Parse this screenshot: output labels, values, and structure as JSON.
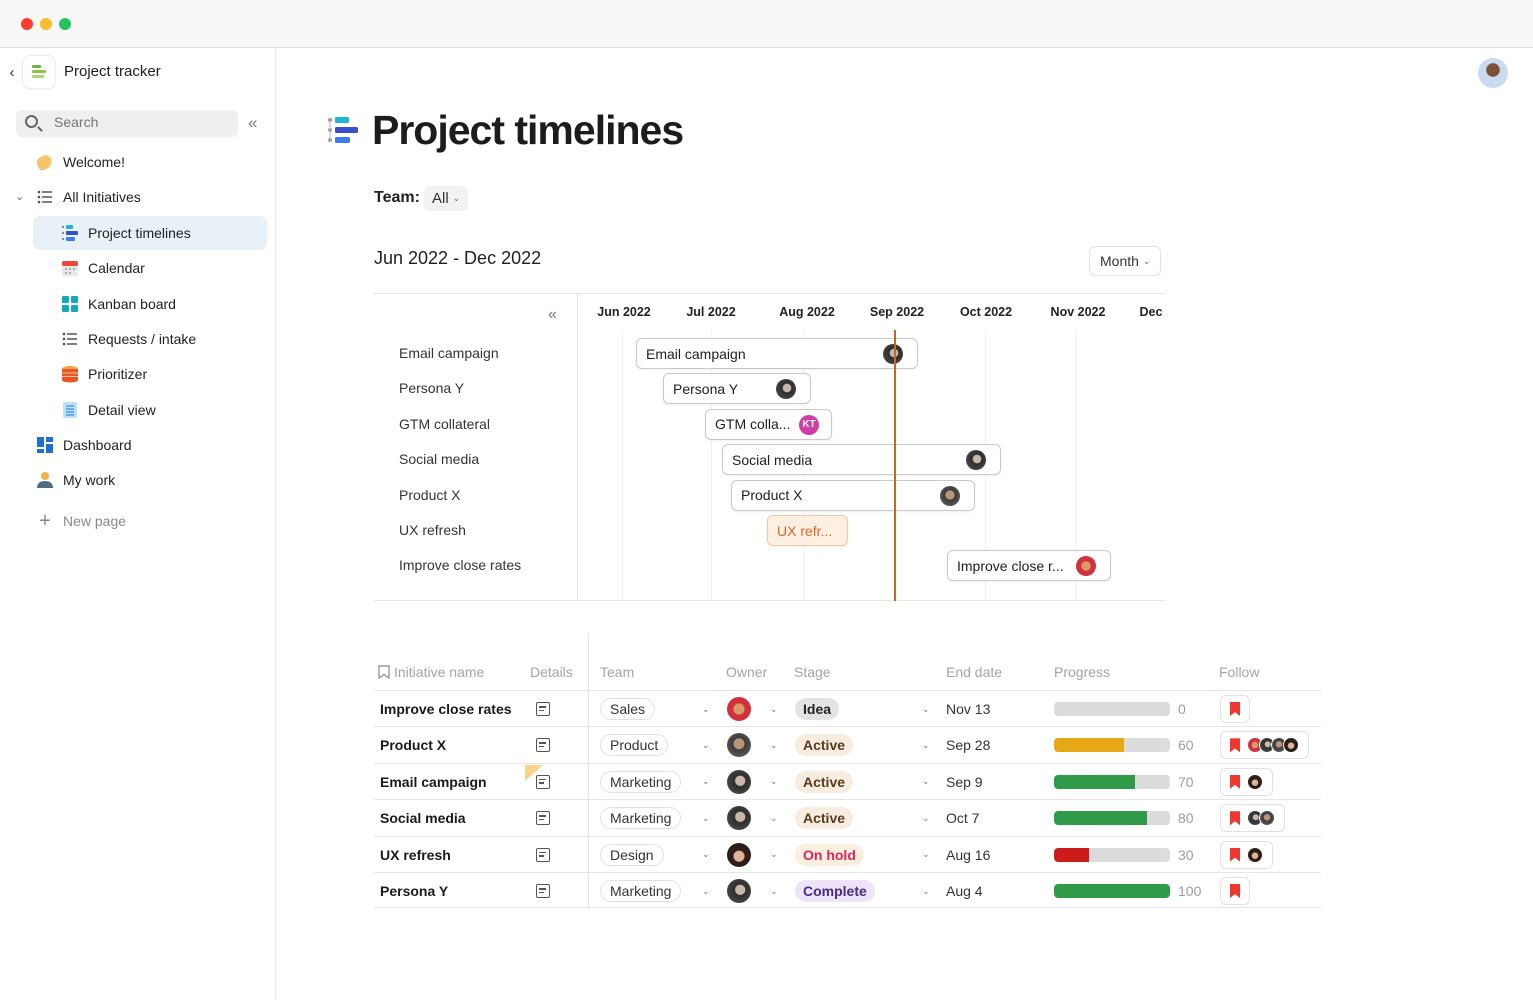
{
  "window": {
    "controls": [
      "close",
      "minimize",
      "maximize"
    ]
  },
  "sidebar": {
    "app_title": "Project tracker",
    "search_placeholder": "Search",
    "items": [
      {
        "label": "Welcome!",
        "icon": "waving-hand-icon",
        "level": 0
      },
      {
        "label": "All Initiatives",
        "icon": "list-icon",
        "level": 0,
        "expanded": true
      },
      {
        "label": "Project timelines",
        "icon": "timeline-icon",
        "level": 1,
        "active": true
      },
      {
        "label": "Calendar",
        "icon": "calendar-icon",
        "level": 1
      },
      {
        "label": "Kanban board",
        "icon": "kanban-icon",
        "level": 1
      },
      {
        "label": "Requests / intake",
        "icon": "list-icon",
        "level": 1
      },
      {
        "label": "Prioritizer",
        "icon": "stack-icon",
        "level": 1
      },
      {
        "label": "Detail view",
        "icon": "detail-icon",
        "level": 1
      },
      {
        "label": "Dashboard",
        "icon": "dashboard-icon",
        "level": 0
      },
      {
        "label": "My work",
        "icon": "person-icon",
        "level": 0
      }
    ],
    "new_page": "New page"
  },
  "page": {
    "title": "Project timelines",
    "team_label": "Team:",
    "team_value": "All"
  },
  "timeline": {
    "range_label": "Jun 2022 - Dec 2022",
    "zoom_value": "Month",
    "months": [
      "Jun 2022",
      "Jul 2022",
      "Aug 2022",
      "Sep 2022",
      "Oct 2022",
      "Nov 2022",
      "Dec"
    ],
    "rows": [
      {
        "label": "Email campaign",
        "bar_text": "Email campaign",
        "owner": "dark"
      },
      {
        "label": "Persona Y",
        "bar_text": "Persona Y",
        "owner": "dark"
      },
      {
        "label": "GTM collateral",
        "bar_text": "GTM colla...",
        "owner": "KT"
      },
      {
        "label": "Social media",
        "bar_text": "Social media",
        "owner": "dark"
      },
      {
        "label": "Product X",
        "bar_text": "Product X",
        "owner": "beard"
      },
      {
        "label": "UX refresh",
        "bar_text": "UX refr...",
        "owner": ""
      },
      {
        "label": "Improve close rates",
        "bar_text": "Improve close r...",
        "owner": "red"
      }
    ]
  },
  "table": {
    "headers": {
      "name": "Initiative name",
      "details": "Details",
      "team": "Team",
      "owner": "Owner",
      "stage": "Stage",
      "end_date": "End date",
      "progress": "Progress",
      "follow": "Follow"
    },
    "rows": [
      {
        "name": "Improve close rates",
        "team": "Sales",
        "stage": "Idea",
        "end_date": "Nov 13",
        "progress": 0,
        "progress_label": "0",
        "followers": 0
      },
      {
        "name": "Product X",
        "team": "Product",
        "stage": "Active",
        "end_date": "Sep 28",
        "progress": 60,
        "progress_label": "60",
        "followers": 4
      },
      {
        "name": "Email campaign",
        "team": "Marketing",
        "stage": "Active",
        "end_date": "Sep 9",
        "progress": 70,
        "progress_label": "70",
        "followers": 1
      },
      {
        "name": "Social media",
        "team": "Marketing",
        "stage": "Active",
        "end_date": "Oct 7",
        "progress": 80,
        "progress_label": "80",
        "followers": 2
      },
      {
        "name": "UX refresh",
        "team": "Design",
        "stage": "On hold",
        "end_date": "Aug 16",
        "progress": 30,
        "progress_label": "30",
        "followers": 1
      },
      {
        "name": "Persona Y",
        "team": "Marketing",
        "stage": "Complete",
        "end_date": "Aug 4",
        "progress": 100,
        "progress_label": "100",
        "followers": 0
      }
    ],
    "stage_colors": {
      "Idea": {
        "bg": "#e3e3e3",
        "fg": "#222222"
      },
      "Active": {
        "bg": "#f6ede0",
        "fg": "#5a3a1a"
      },
      "On hold": {
        "bg": "#fcefe0",
        "fg": "#e0245e"
      },
      "Complete": {
        "bg": "#ede4f8",
        "fg": "#4a2a8a"
      }
    },
    "progress_colors": {
      "Active-60": "#e6a817",
      "default": "#2f9a48",
      "On hold": "#cc1b1b"
    }
  },
  "colors": {
    "today_line": "#c8652a",
    "accent": "#e8f1f7"
  }
}
